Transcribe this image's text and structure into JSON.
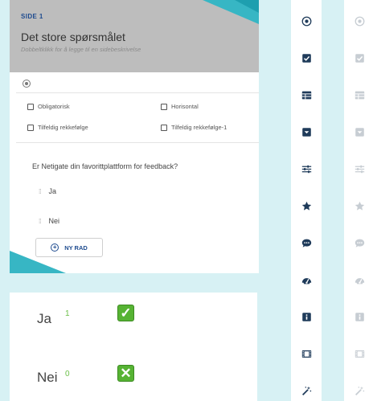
{
  "editor": {
    "page_label": "SIDE 1",
    "title": "Det store spørsmålet",
    "description": "Dobbeltklikk for å legge til en sidebeskrivelse",
    "options": [
      {
        "label": "Obligatorisk"
      },
      {
        "label": "Horisontal"
      },
      {
        "label": "Tilfeldig rekkefølge"
      },
      {
        "label": "Tilfeldig rekkefølge-1"
      }
    ],
    "question": "Er Netigate din favorittplattform for feedback?",
    "answers": [
      {
        "label": "Ja"
      },
      {
        "label": "Nei"
      }
    ],
    "new_row_label": "NY RAD"
  },
  "results": [
    {
      "label": "Ja",
      "count": "1",
      "mark": "check-icon",
      "mark_glyph": "✓"
    },
    {
      "label": "Nei",
      "count": "0",
      "mark": "cross-icon",
      "mark_glyph": "✕"
    }
  ],
  "colors": {
    "background": "#d7f1f4",
    "accent_teal": "#37b6c4",
    "icon_active": "#1f3b5a",
    "icon_inactive": "#c7cdd3",
    "count_green": "#6cc04a",
    "mark_green": "#56b333"
  },
  "toolbars": [
    {
      "state": "active",
      "icons": [
        "radio-button-icon",
        "checkbox-icon",
        "grid-table-icon",
        "dropdown-icon",
        "sliders-icon",
        "star-icon",
        "comment-icon",
        "gauge-icon",
        "info-icon",
        "film-icon",
        "magic-wand-icon"
      ]
    },
    {
      "state": "inactive",
      "icons": [
        "radio-button-icon",
        "checkbox-icon",
        "grid-table-icon",
        "dropdown-icon",
        "sliders-icon",
        "star-icon",
        "comment-icon",
        "gauge-icon",
        "info-icon",
        "film-icon",
        "magic-wand-icon"
      ]
    }
  ]
}
